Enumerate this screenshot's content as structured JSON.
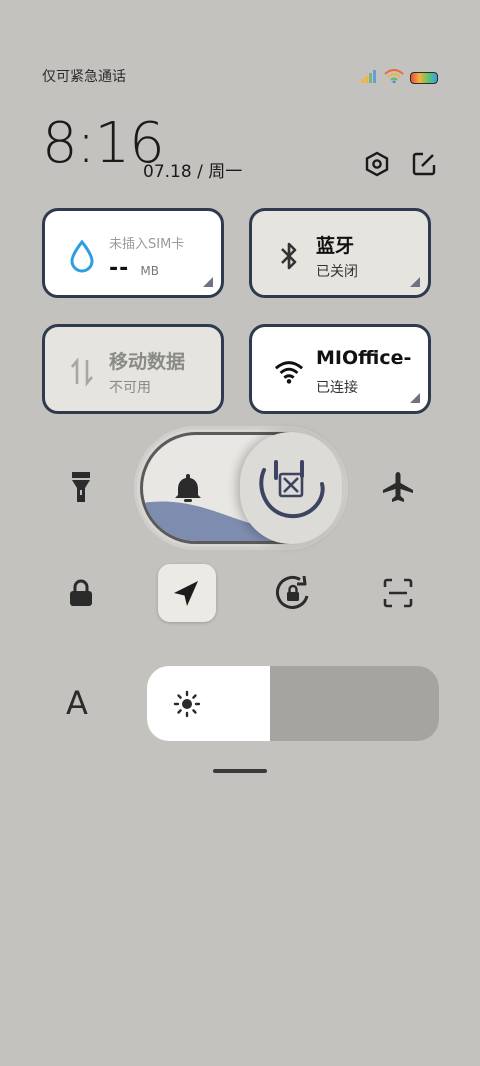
{
  "status_bar": {
    "carrier_text": "仅可紧急通话",
    "icons": [
      "signal-icon",
      "wifi-icon",
      "battery-icon"
    ]
  },
  "header": {
    "time": "8:16",
    "date": "07.18 / 周一"
  },
  "tiles": {
    "data_usage": {
      "label": "未插入SIM卡",
      "value": "--",
      "unit": "MB"
    },
    "bluetooth": {
      "title": "蓝牙",
      "status": "已关闭"
    },
    "mobile_data": {
      "title": "移动数据",
      "status": "不可用"
    },
    "wifi": {
      "title": "MIOffice-",
      "status": "已连接"
    }
  },
  "controls": {
    "row1": [
      "flashlight-icon",
      "bell-icon",
      "silent-mode-icon",
      "airplane-icon"
    ],
    "row2": [
      "lock-icon",
      "location-icon",
      "rotation-lock-icon",
      "scan-icon"
    ]
  },
  "brightness": {
    "level": 0.42,
    "text_size_label": "A"
  },
  "colors": {
    "background": "#c3c2be",
    "tile_border": "#2f3a4e",
    "wave": "#7e8cb0",
    "brightness_fill": "#ffffff"
  }
}
